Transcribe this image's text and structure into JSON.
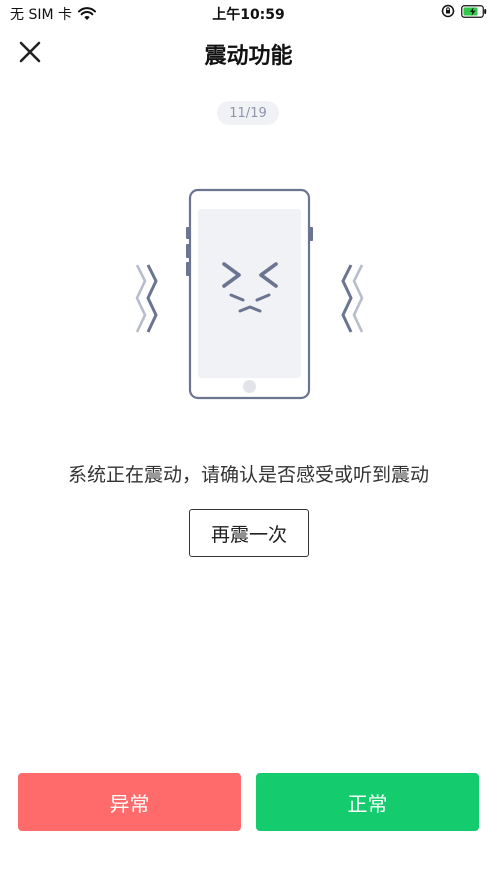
{
  "status_bar": {
    "carrier": "无 SIM 卡",
    "time": "上午10:59",
    "battery_color": "#2ec946"
  },
  "header": {
    "title": "震动功能",
    "close_icon": "close-icon"
  },
  "progress": {
    "label": "11/19"
  },
  "illustration": {
    "icon": "vibrating-phone-icon",
    "stroke_color": "#6b7490",
    "screen_color": "#f1f2f5"
  },
  "main": {
    "instruction": "系统正在震动，请确认是否感受或听到震动",
    "vibrate_again_label": "再震一次"
  },
  "actions": {
    "abnormal_label": "异常",
    "normal_label": "正常",
    "abnormal_color": "#ff6b6b",
    "normal_color": "#14cc6e"
  }
}
